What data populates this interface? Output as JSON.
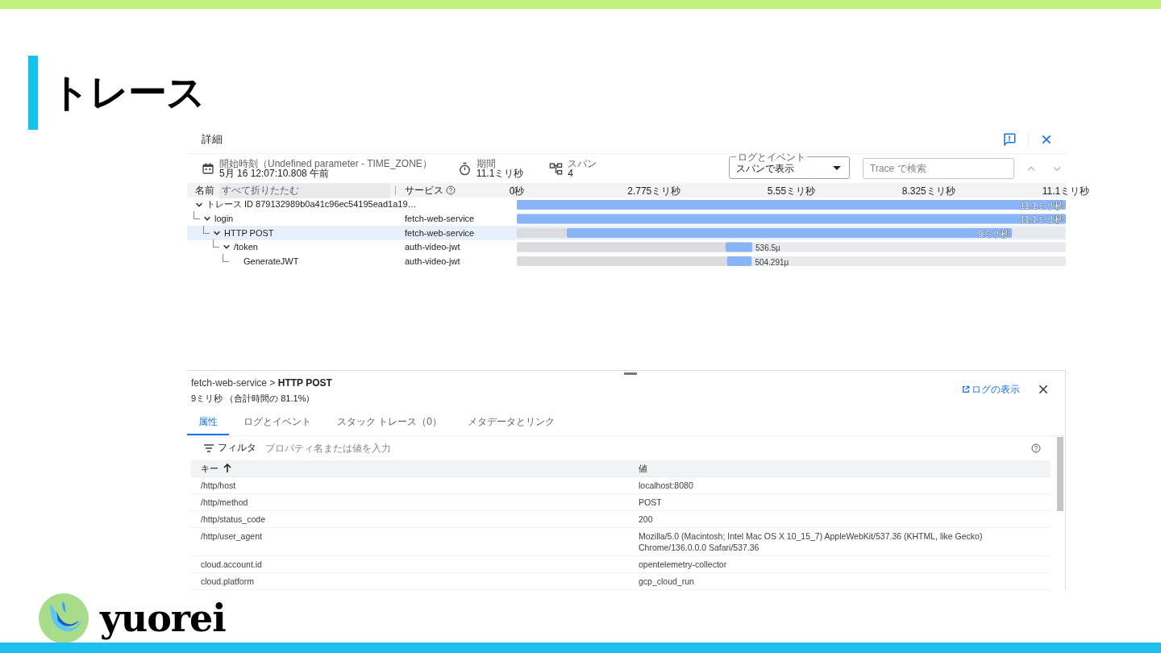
{
  "slide": {
    "title": "トレース",
    "brand": "yuorei"
  },
  "details": {
    "title": "詳細",
    "info": [
      {
        "kind": "start",
        "label": "開始時刻（Undefined parameter - TIME_ZONE）",
        "value": "5月 16 12:07:10.808 午前"
      },
      {
        "kind": "duration",
        "label": "期間",
        "value": "11.1ミリ秒"
      },
      {
        "kind": "spans",
        "label": "スパン",
        "value": "4"
      }
    ],
    "view_select": {
      "label": "ログとイベント",
      "value": "スパンで表示"
    },
    "search": {
      "placeholder": "Trace で検索"
    },
    "columns": {
      "name": "名前",
      "collapse_all": "すべて折りたたむ",
      "service": "サービス"
    },
    "spans": [
      {
        "name": "トレース ID 879132989b0a41c96ec54195ead1a19…",
        "expanded": true,
        "selected": false,
        "children": [
          {
            "name": "login",
            "service": "fetch-web-service",
            "expanded": true,
            "selected": false,
            "children": [
              {
                "name": "HTTP POST",
                "service": "fetch-web-service",
                "expanded": true,
                "selected": true,
                "children": [
                  {
                    "name": "/token",
                    "service": "auth-video-jwt",
                    "expanded": true,
                    "selected": false,
                    "children": [
                      {
                        "name": "GenerateJWT",
                        "service": "auth-video-jwt",
                        "selected": false
                      }
                    ]
                  }
                ]
              }
            ]
          }
        ]
      }
    ],
    "timeline": {
      "chart_data": {
        "type": "bar",
        "orientation": "horizontal",
        "stacked": true,
        "xlim": [
          0,
          11.1
        ],
        "categories": [
          null,
          null,
          null,
          null,
          null
        ],
        "xticks": [
          {
            "value": 0,
            "label": "0秒"
          },
          {
            "value": 2.775,
            "label": "2.775ミリ秒"
          },
          {
            "value": 5.55,
            "label": "5.55ミリ秒"
          },
          {
            "value": 8.325,
            "label": "8.325ミリ秒"
          },
          {
            "value": 11.1,
            "label": "11.1ミリ秒"
          }
        ],
        "series": [
          {
            "color": "#dadce0",
            "values": [
              0,
              0,
              1.01,
              4.22,
              4.25
            ]
          },
          {
            "color": "#8ab4f8",
            "values": [
              11.1,
              11.1,
              9,
              0.54,
              0.5
            ]
          }
        ],
        "value_labels": [
          "11.1ミリ秒",
          "11.1ミリ秒",
          "9ミリ秒",
          "536.5μ",
          "504.291μ"
        ]
      }
    }
  },
  "span_detail": {
    "breadcrumb": "fetch-web-service > **HTTP POST**",
    "summary": "9ミリ秒 （合計時間の 81.1%）",
    "log_link": "ログの表示",
    "tabs": [
      {
        "label": "属性",
        "selected": true
      },
      {
        "label": "ログとイベント",
        "selected": false
      },
      {
        "label": "スタック トレース（0）",
        "selected": false
      },
      {
        "label": "メタデータとリンク",
        "selected": false
      }
    ],
    "filter": {
      "label": "フィルタ",
      "placeholder": "プロパティ名または値を入力"
    },
    "table": {
      "columns": [
        "キー",
        "値"
      ],
      "rows": [
        {
          "key": "/http/host",
          "value": "localhost:8080"
        },
        {
          "key": "/http/method",
          "value": "POST"
        },
        {
          "key": "/http/status_code",
          "value": "200"
        },
        {
          "key": "/http/user_agent",
          "value": "Mozilla/5.0 (Macintosh; Intel Mac OS X 10_15_7) AppleWebKit/537.36 (KHTML, like Gecko) Chrome/136.0.0.0 Safari/537.36"
        },
        {
          "key": "cloud.account.id",
          "value": "opentelemetry-collector"
        },
        {
          "key": "cloud.platform",
          "value": "gcp_cloud_run"
        }
      ]
    }
  }
}
